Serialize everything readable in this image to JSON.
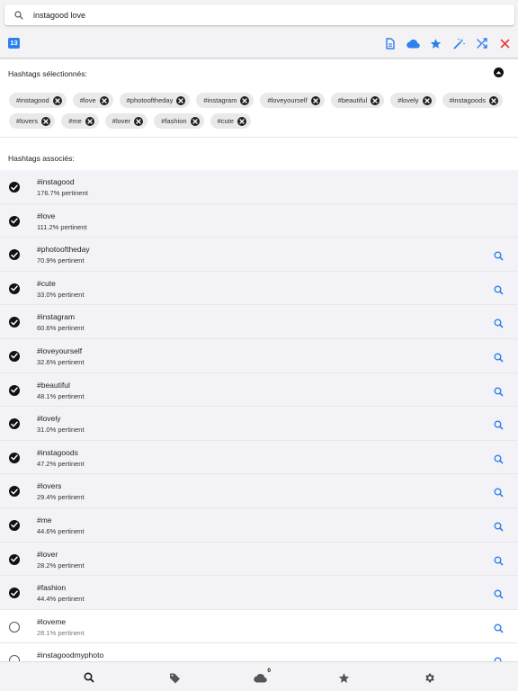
{
  "search": {
    "value": "instagood love"
  },
  "toolbar": {
    "count": "13",
    "actions": [
      "copy-icon",
      "cloud-icon",
      "star-icon",
      "magic-wand-icon",
      "shuffle-icon",
      "close-icon"
    ],
    "accent": "#2f80ed",
    "danger": "#e53935"
  },
  "selected_section": {
    "title": "Hashtags sélectionnés:",
    "chips": [
      "#instagood",
      "#love",
      "#photooftheday",
      "#instagram",
      "#loveyourself",
      "#beautiful",
      "#lovely",
      "#instagoods",
      "#lovers",
      "#me",
      "#lover",
      "#fashion",
      "#cute"
    ]
  },
  "related_section": {
    "title": "Hashtags associés:",
    "items": [
      {
        "tag": "#instagood",
        "relevance": "176.7% pertinent",
        "selected": true,
        "search": false
      },
      {
        "tag": "#love",
        "relevance": "111.2% pertinent",
        "selected": true,
        "search": false
      },
      {
        "tag": "#photooftheday",
        "relevance": "70.9% pertinent",
        "selected": true,
        "search": true
      },
      {
        "tag": "#cute",
        "relevance": "33.0% pertinent",
        "selected": true,
        "search": true
      },
      {
        "tag": "#instagram",
        "relevance": "60.6% pertinent",
        "selected": true,
        "search": true
      },
      {
        "tag": "#loveyourself",
        "relevance": "32.6% pertinent",
        "selected": true,
        "search": true
      },
      {
        "tag": "#beautiful",
        "relevance": "48.1% pertinent",
        "selected": true,
        "search": true
      },
      {
        "tag": "#lovely",
        "relevance": "31.0% pertinent",
        "selected": true,
        "search": true
      },
      {
        "tag": "#instagoods",
        "relevance": "47.2% pertinent",
        "selected": true,
        "search": true
      },
      {
        "tag": "#lovers",
        "relevance": "29.4% pertinent",
        "selected": true,
        "search": true
      },
      {
        "tag": "#me",
        "relevance": "44.6% pertinent",
        "selected": true,
        "search": true
      },
      {
        "tag": "#lover",
        "relevance": "28.2% pertinent",
        "selected": true,
        "search": true
      },
      {
        "tag": "#fashion",
        "relevance": "44.4% pertinent",
        "selected": true,
        "search": true
      },
      {
        "tag": "#loveme",
        "relevance": "28.1% pertinent",
        "selected": false,
        "search": true
      },
      {
        "tag": "#instagoodmyphoto",
        "relevance": "",
        "selected": false,
        "search": true
      }
    ]
  },
  "bottom_nav": {
    "items": [
      "search-icon",
      "tags-icon",
      "cloud-icon",
      "star-icon",
      "gear-icon"
    ],
    "cloud_count": "0"
  }
}
